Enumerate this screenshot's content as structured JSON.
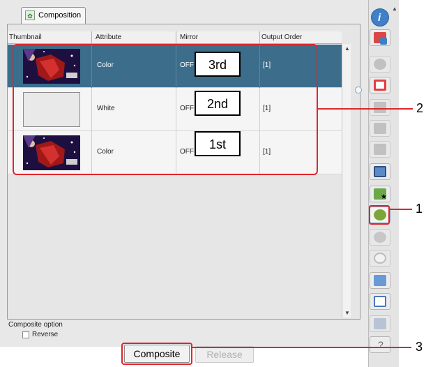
{
  "tab": {
    "label": "Composition",
    "icon": "composition-icon"
  },
  "table": {
    "headers": [
      "Thumbnail",
      "Attribute",
      "Mirror",
      "Output Order"
    ],
    "rows": [
      {
        "thumb": "image",
        "attribute": "Color",
        "mirror": "OFF",
        "order_label": "3rd",
        "output_order": "[1]",
        "selected": true
      },
      {
        "thumb": "blank",
        "attribute": "White",
        "mirror": "OFF",
        "order_label": "2nd",
        "output_order": "[1]",
        "selected": false
      },
      {
        "thumb": "image",
        "attribute": "Color",
        "mirror": "OFF",
        "order_label": "1st",
        "output_order": "[1]",
        "selected": false
      }
    ]
  },
  "option": {
    "title": "Composite option",
    "reverse_label": "Reverse",
    "reverse_checked": false
  },
  "buttons": {
    "composite": "Composite",
    "release": "Release"
  },
  "callouts": {
    "c1": "1",
    "c2": "2",
    "c3": "3"
  },
  "colors": {
    "selected_row": "#3c6e8c",
    "callout": "#e0262c",
    "toolbar_active": "#7aa63a"
  },
  "toolbar": [
    "info-icon",
    "import-icon",
    "disabled-icon",
    "frame-icon",
    "disabled-icon",
    "disabled-icon",
    "disabled-icon",
    "layout-icon",
    "add-favorite-icon",
    "composition-icon",
    "move-icon",
    "rotate-icon",
    "copy-icon",
    "swap-icon",
    "trash-icon",
    "help-icon"
  ]
}
